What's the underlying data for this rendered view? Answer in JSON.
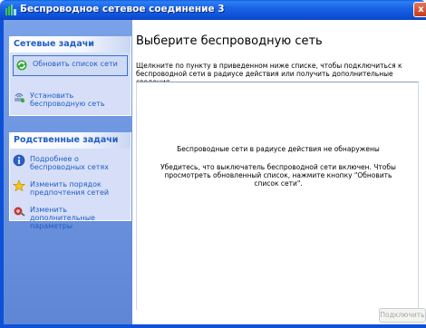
{
  "window": {
    "title": "Беспроводное сетевое соединение 3",
    "close_glyph": "x"
  },
  "network_tasks": {
    "header": "Сетевые задачи",
    "items": [
      {
        "label": "Обновить список сети",
        "icon": "refresh-network-icon"
      },
      {
        "label": "Установить беспроводную сеть",
        "icon": "wireless-setup-icon"
      }
    ]
  },
  "related_tasks": {
    "header": "Родственные задачи",
    "items": [
      {
        "label": "Подробнее о беспроводных сетях",
        "icon": "info-icon"
      },
      {
        "label": "Изменить порядок предпочтения сетей",
        "icon": "star-icon"
      },
      {
        "label": "Изменить дополнительные параметры",
        "icon": "settings-icon"
      }
    ]
  },
  "main": {
    "title": "Выберите беспроводную сеть",
    "instructions": "Щелкните по пункту в приведенном ниже списке, чтобы подключиться к беспроводной сети в радиусе действия или получить дополнительные сведения.",
    "no_networks": "Беспроводные сети в радиусе действия не обнаружены",
    "hint": "Убедитесь, что выключатель беспроводной сети включен. Чтобы просмотреть обновленный список, нажмите кнопку \"Обновить список сети\".",
    "connect_button": "Подключить"
  },
  "colors": {
    "titlebar": "#0c4fd6",
    "taskpane": "#6f96e0",
    "task_link": "#215dc6"
  }
}
